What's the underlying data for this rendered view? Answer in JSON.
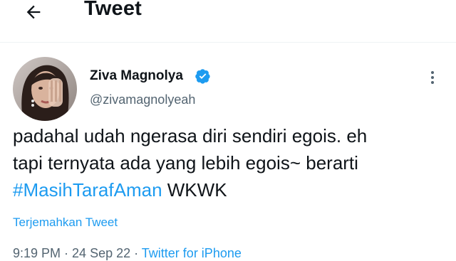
{
  "header": {
    "back_icon": "arrow-left-icon",
    "title": "Tweet"
  },
  "tweet": {
    "author": {
      "display_name": "Ziva Magnolya",
      "handle": "@zivamagnolyeah",
      "verified_icon": "verified-badge-icon"
    },
    "more_icon": "more-vertical-icon",
    "text_lines": {
      "line1": "padahal udah ngerasa diri sendiri egois. eh",
      "line2": "tapi ternyata ada yang lebih egois~ berarti",
      "hashtag": "#MasihTarafAman",
      "line3_rest": " WKWK"
    },
    "translate_label": "Terjemahkan Tweet",
    "meta": {
      "time": "9:19 PM",
      "sep1": " · ",
      "date": "24 Sep 22",
      "sep2": " · ",
      "source": "Twitter for iPhone"
    }
  },
  "colors": {
    "accent": "#1d9bf0",
    "text": "#0f1419",
    "secondary": "#536471"
  }
}
